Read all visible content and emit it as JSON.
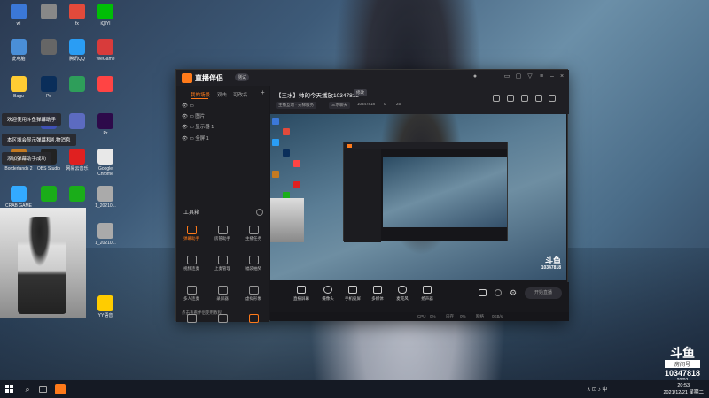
{
  "desktop": {
    "icons": [
      {
        "label": "wi",
        "color": "#3b78d8"
      },
      {
        "label": "",
        "color": "#888888"
      },
      {
        "label": "fx",
        "color": "#e24a3b"
      },
      {
        "label": "iQIYI",
        "color": "#00be06"
      },
      {
        "label": "此电脑",
        "color": "#4a8fd8"
      },
      {
        "label": "",
        "color": "#666666"
      },
      {
        "label": "腾讯QQ",
        "color": "#2a9df4"
      },
      {
        "label": "WeGame",
        "color": "#d83b3b"
      },
      {
        "label": "Bagu",
        "color": "#ffcc33"
      },
      {
        "label": "Ps",
        "color": "#0a2e5a"
      },
      {
        "label": "",
        "color": "#2e9e5a"
      },
      {
        "label": "",
        "color": "#ff4444"
      },
      {
        "label": "",
        "color": "#3f51b5"
      },
      {
        "label": "",
        "color": "#5c6bc0"
      },
      {
        "label": "Pr",
        "color": "#2d0a4a"
      },
      {
        "label": "Borderlands 2",
        "color": "#c47a22"
      },
      {
        "label": "OBS Studio",
        "color": "#222222"
      },
      {
        "label": "网易云音乐",
        "color": "#e02020"
      },
      {
        "label": "Google Chrome",
        "color": "#e8e8e8"
      },
      {
        "label": "CRAB GAME",
        "color": "#33aaff"
      },
      {
        "label": "",
        "color": "#1aad19"
      },
      {
        "label": "",
        "color": "#1aad19"
      },
      {
        "label": "1_20210...",
        "color": "#aaaaaa"
      },
      {
        "label": "1_20210...",
        "color": "#aaaaaa"
      },
      {
        "label": "",
        "color": "#ff8c1a"
      },
      {
        "label": "",
        "color": "#ffb020"
      },
      {
        "label": "YY语音",
        "color": "#ffcc00"
      }
    ]
  },
  "toasts": [
    "欢迎使用斗鱼弹幕助手",
    "本区域会显示弹幕和礼物消息",
    "添加弹幕助手成功"
  ],
  "app": {
    "name": "直播伴侣",
    "version": "测试",
    "sidebar": {
      "tabs": [
        "我的场景",
        "双击",
        "可改名"
      ],
      "sources": [
        "",
        "图片",
        "显示器 1",
        "全屏 1"
      ],
      "tools_title": "工具箱",
      "tools": [
        "弹幕助手",
        "房管助手",
        "主播任务",
        "视频连麦",
        "上麦管理",
        "福袋抽奖",
        "多人连麦",
        "录屏器",
        "虚拟形象",
        "",
        "",
        ""
      ],
      "footer": "点击查看伴侣使用教程"
    },
    "room": {
      "title": "【三水】帅的今天播放10347818",
      "edit_tag": "修改",
      "meta": [
        "主播互动 · 天梯服务",
        "三水聊天",
        "10347818",
        "0",
        "25"
      ]
    },
    "preview": {
      "logo_line1": "斗鱼",
      "logo_line2": "10347818"
    },
    "controls": [
      "直播屏幕",
      "摄像头",
      "手机投屏",
      "多媒体",
      "麦克风",
      "扬声器"
    ],
    "start_label": "开始直播",
    "status": [
      "CPU",
      "0%",
      "内存",
      "0%",
      "网络",
      "0KB/s"
    ]
  },
  "watermark": {
    "logo": "斗鱼",
    "sub": "房间号",
    "room_id": "10347818",
    "extra": "20/03"
  },
  "taskbar": {
    "tray": "∧ ⊡ ♪ 中",
    "time": "20:53",
    "date": "2021/12/21 星期二"
  }
}
